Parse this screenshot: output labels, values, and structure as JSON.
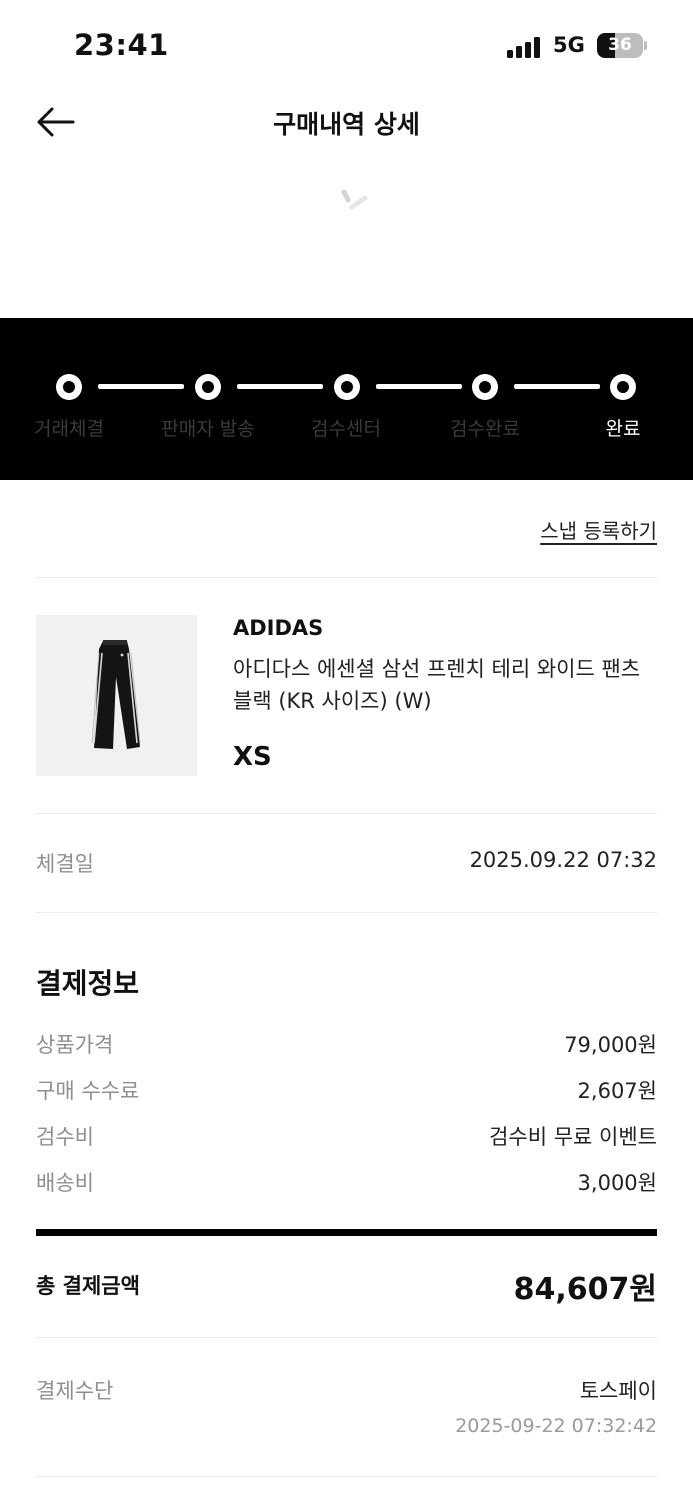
{
  "status_bar": {
    "time": "23:41",
    "network": "5G",
    "battery": "36"
  },
  "header": {
    "title": "구매내역 상세",
    "back_icon": "arrow-left-icon"
  },
  "progress": {
    "steps": [
      "거래체결",
      "판매자 발송",
      "검수센터",
      "검수완료",
      "완료"
    ],
    "current_step": "완료"
  },
  "snap_link": "스냅 등록하기",
  "product": {
    "brand": "ADIDAS",
    "name": "아디다스 에센셜 삼선 프렌치 테리 와이드 팬츠 블랙 (KR 사이즈) (W)",
    "size": "XS"
  },
  "trade": {
    "label": "체결일",
    "value": "2025.09.22 07:32"
  },
  "payment_info": {
    "title": "결제정보",
    "rows": [
      {
        "label": "상품가격",
        "value": "79,000원"
      },
      {
        "label": "구매 수수료",
        "value": "2,607원"
      },
      {
        "label": "검수비",
        "value": "검수비 무료 이벤트"
      },
      {
        "label": "배송비",
        "value": "3,000원"
      }
    ],
    "total_label": "총 결제금액",
    "total_value": "84,607원"
  },
  "payment_method": {
    "label": "결제수단",
    "value": "토스페이",
    "timestamp": "2025-09-22 07:32:42"
  },
  "colors": {
    "progress_bg": "#000000",
    "muted_text": "#8f8f8f",
    "active_step": "#ffffff"
  }
}
